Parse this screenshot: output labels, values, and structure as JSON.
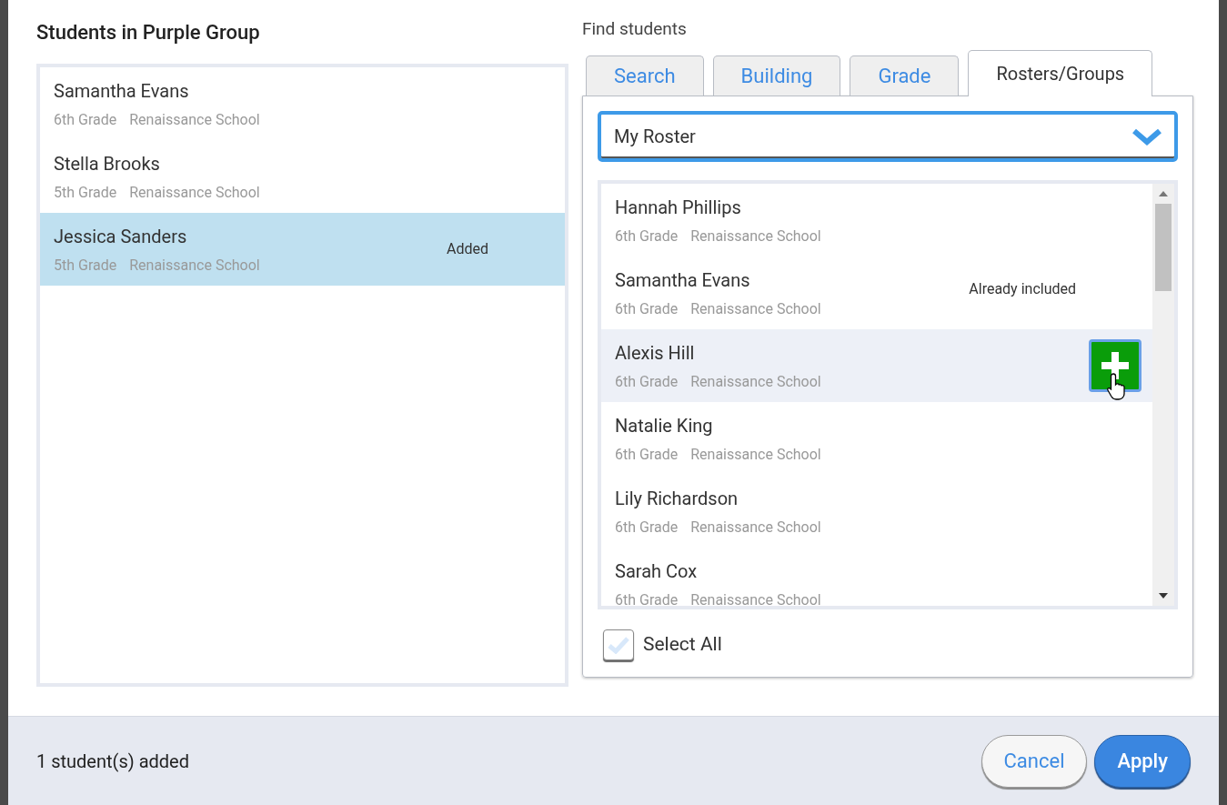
{
  "group_panel": {
    "title": "Students in Purple Group",
    "students": [
      {
        "name": "Samantha Evans",
        "grade": "6th Grade",
        "school": "Renaissance School",
        "highlighted": false
      },
      {
        "name": "Stella Brooks",
        "grade": "5th Grade",
        "school": "Renaissance School",
        "highlighted": false
      },
      {
        "name": "Jessica Sanders",
        "grade": "5th Grade",
        "school": "Renaissance School",
        "highlighted": true,
        "status": "Added"
      }
    ]
  },
  "find_panel": {
    "title": "Find students",
    "tabs": [
      {
        "label": "Search",
        "selected": false
      },
      {
        "label": "Building",
        "selected": false
      },
      {
        "label": "Grade",
        "selected": false
      },
      {
        "label": "Rosters/Groups",
        "selected": true
      }
    ],
    "roster_select": {
      "value": "My Roster"
    },
    "results": [
      {
        "name": "Hannah Phillips",
        "grade": "6th Grade",
        "school": "Renaissance School",
        "highlighted": false,
        "add_button": false
      },
      {
        "name": "Samantha Evans",
        "grade": "6th Grade",
        "school": "Renaissance School",
        "highlighted": false,
        "add_button": false,
        "status": "Already included"
      },
      {
        "name": "Alexis Hill",
        "grade": "6th Grade",
        "school": "Renaissance School",
        "highlighted": true,
        "add_button": true
      },
      {
        "name": "Natalie King",
        "grade": "6th Grade",
        "school": "Renaissance School",
        "highlighted": false,
        "add_button": false
      },
      {
        "name": "Lily Richardson",
        "grade": "6th Grade",
        "school": "Renaissance School",
        "highlighted": false,
        "add_button": false
      },
      {
        "name": "Sarah Cox",
        "grade": "6th Grade",
        "school": "Renaissance School",
        "highlighted": false,
        "add_button": false
      }
    ],
    "select_all": {
      "label": "Select All",
      "checked": false
    }
  },
  "footer": {
    "summary": "1 student(s) added",
    "buttons": [
      {
        "label": "Cancel",
        "kind": "secondary"
      },
      {
        "label": "Apply",
        "kind": "primary"
      }
    ]
  }
}
